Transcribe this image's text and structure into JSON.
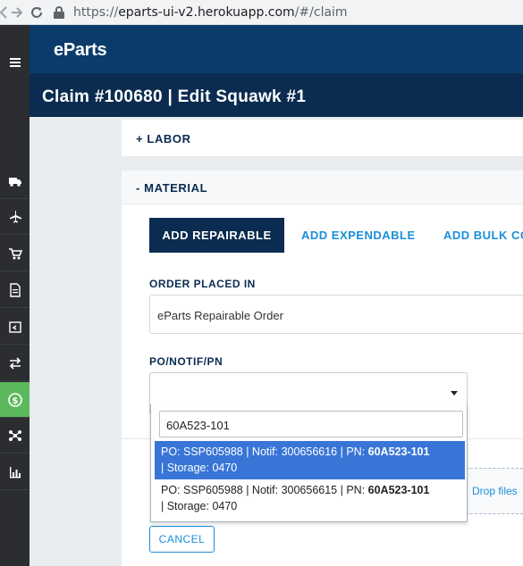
{
  "browser": {
    "url_scheme": "https://",
    "url_host": "eparts-ui-v2.herokuapp.com",
    "url_path": "/#/claim"
  },
  "sidebar": {
    "items": [
      {
        "icon": "menu-icon",
        "active": false
      },
      {
        "icon": "truck-icon",
        "active": false
      },
      {
        "icon": "airplane-icon",
        "active": false
      },
      {
        "icon": "cart-icon",
        "active": false
      },
      {
        "icon": "document-icon",
        "active": false
      },
      {
        "icon": "return-box-icon",
        "active": false
      },
      {
        "icon": "exchange-icon",
        "active": false
      },
      {
        "icon": "dollar-icon",
        "active": true
      },
      {
        "icon": "network-icon",
        "active": false
      },
      {
        "icon": "bar-chart-icon",
        "active": false
      }
    ]
  },
  "header": {
    "logo": "eParts",
    "title": "Claim #100680 | Edit Squawk #1"
  },
  "labor": {
    "label": "+ LABOR"
  },
  "material": {
    "label": "- MATERIAL",
    "tabs": [
      {
        "label": "ADD REPAIRABLE",
        "active": true
      },
      {
        "label": "ADD EXPENDABLE",
        "active": false
      },
      {
        "label": "ADD BULK CO",
        "active": false
      }
    ],
    "order_placed_label": "ORDER PLACED IN",
    "order_placed_value": "eParts Repairable Order",
    "po_label": "PO/NOTIF/PN",
    "dropzone_text": "Drop files",
    "cancel_label": "CANCEL"
  },
  "dropdown": {
    "search_value": "60A523-101",
    "options": [
      {
        "prefix": "PO: SSP605988 | Notif: 300656616 | PN: ",
        "pn": "60A523-101",
        "suffix": "| Storage: 0470",
        "highlighted": true
      },
      {
        "prefix": "PO: SSP605988 | Notif: 300656615 | PN: ",
        "pn": "60A523-101",
        "suffix": "| Storage: 0470",
        "highlighted": false
      }
    ]
  },
  "colors": {
    "header_bg": "#0a3b6b",
    "title_bg": "#0b2c50",
    "sidebar_bg": "#2b2d30",
    "active_green": "#5cb85c",
    "link_blue": "#1a8fd8",
    "highlight_blue": "#3875d7"
  }
}
